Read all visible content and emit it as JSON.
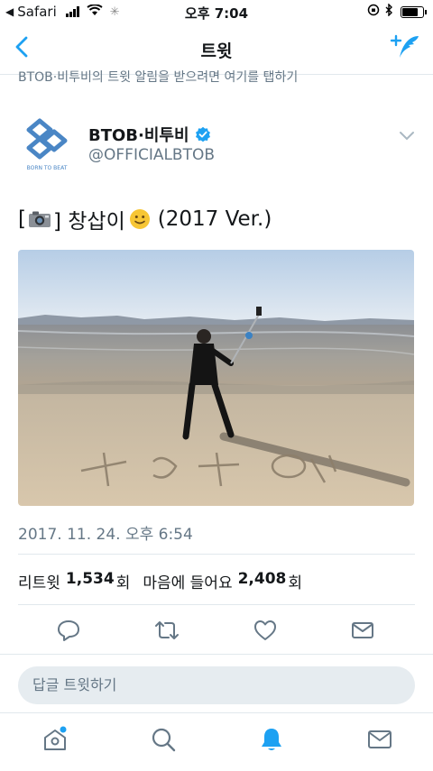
{
  "status_bar": {
    "back_app": "Safari",
    "time": "오후 7:04"
  },
  "nav": {
    "title": "트윗",
    "back_icon": "chevron-left-icon",
    "compose_icon": "compose-tweet-icon"
  },
  "reply_hint": "BTOB·비투비의 트윗 알림을 받으려면 여기를 탭하기",
  "author": {
    "display_name": "BTOB·비투비",
    "handle": "@OFFICIALBTOB",
    "logo_text": "BORN TO BEAT",
    "verified": true
  },
  "tweet": {
    "text_open": "[",
    "text_close": "] 창삽이",
    "text_suffix": "(2017 Ver.)",
    "timestamp": "2017. 11. 24. 오후 6:54"
  },
  "stats": {
    "retweet_label": "리트윗",
    "retweet_count": "1,534",
    "retweet_unit": "회",
    "like_label": "마음에 들어요",
    "like_count": "2,408",
    "like_unit": "회"
  },
  "actions": [
    "reply-icon",
    "retweet-icon",
    "like-icon",
    "direct-message-icon"
  ],
  "reply_box": {
    "placeholder": "답글 트윗하기"
  },
  "tabs": [
    "home-icon",
    "search-icon",
    "notifications-icon",
    "messages-icon"
  ],
  "colors": {
    "accent": "#1da1f2",
    "text": "#14171a",
    "secondary": "#657786",
    "logo": "#4a86c5"
  }
}
